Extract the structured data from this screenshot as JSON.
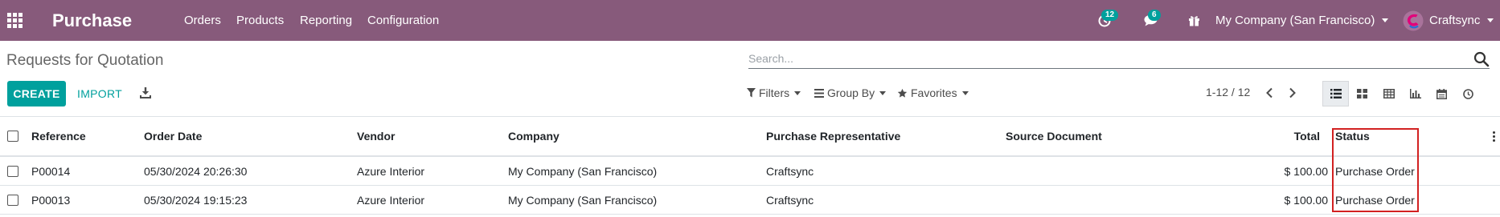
{
  "navbar": {
    "app_name": "Purchase",
    "menu": [
      "Orders",
      "Products",
      "Reporting",
      "Configuration"
    ],
    "activity_count": "12",
    "messages_count": "6",
    "company": "My Company (San Francisco)",
    "user": "Craftsync",
    "icons": [
      "apps-grid-icon",
      "clock-icon",
      "chat-icon",
      "gift-icon",
      "company-caret",
      "avatar"
    ]
  },
  "control_panel": {
    "title": "Requests for Quotation",
    "search_placeholder": "Search...",
    "create_label": "CREATE",
    "import_label": "IMPORT",
    "filters_label": "Filters",
    "groupby_label": "Group By",
    "favorites_label": "Favorites",
    "pager": "1-12 / 12",
    "views": [
      "list",
      "kanban",
      "pivot",
      "graph",
      "calendar",
      "activity"
    ],
    "active_view": "list"
  },
  "table": {
    "columns": [
      "Reference",
      "Order Date",
      "Vendor",
      "Company",
      "Purchase Representative",
      "Source Document",
      "Total",
      "Status"
    ],
    "rows": [
      [
        "P00014",
        "05/30/2024 20:26:30",
        "Azure Interior",
        "My Company (San Francisco)",
        "Craftsync",
        "",
        "$ 100.00",
        "Purchase Order"
      ],
      [
        "P00013",
        "05/30/2024 19:15:23",
        "Azure Interior",
        "My Company (San Francisco)",
        "Craftsync",
        "",
        "$ 100.00",
        "Purchase Order"
      ]
    ]
  },
  "colors": {
    "navbar": "#875a7b",
    "primary": "#00a09d",
    "highlight": "#d22121"
  }
}
